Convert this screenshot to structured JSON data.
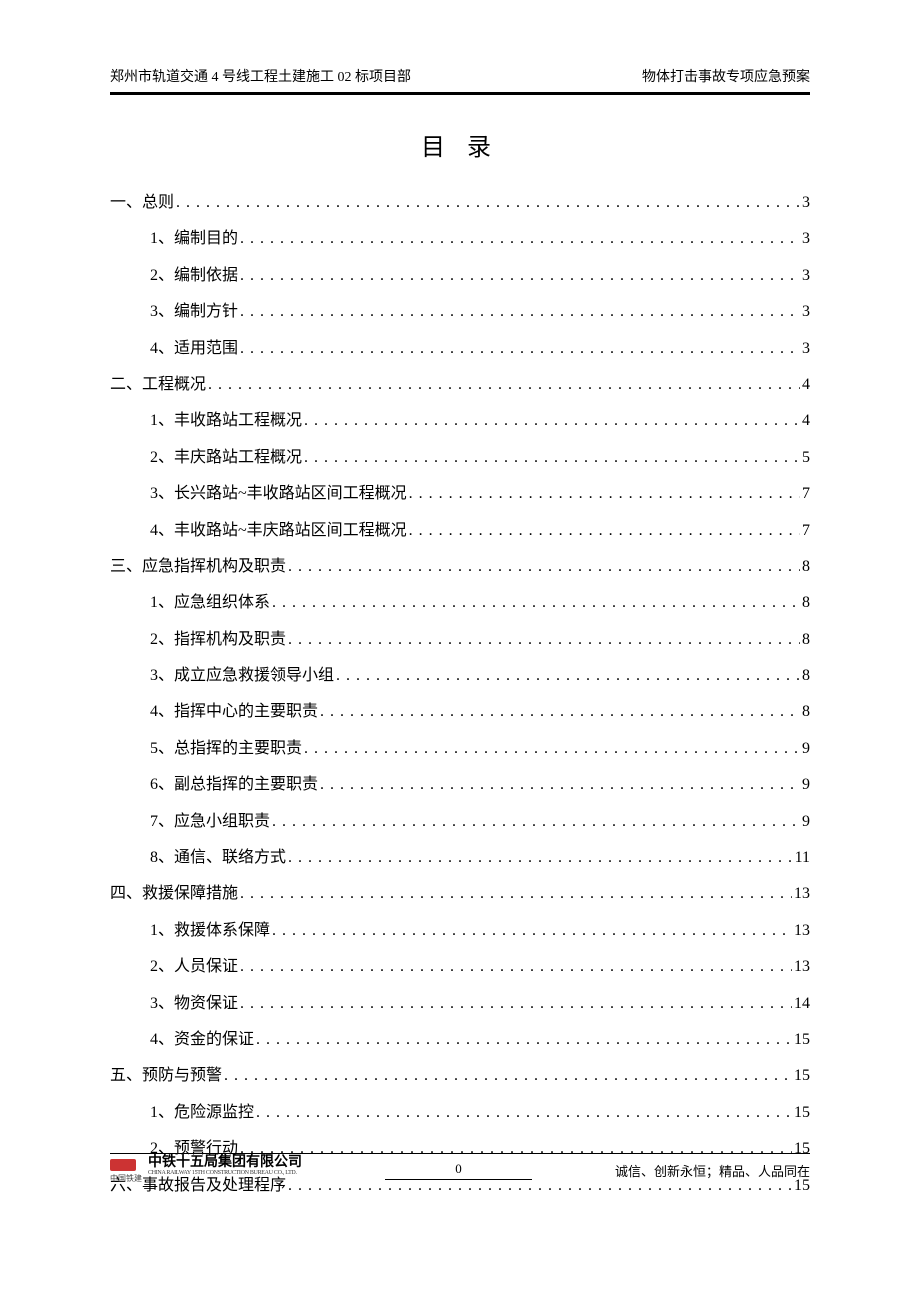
{
  "header": {
    "left": "郑州市轨道交通 4 号线工程土建施工 02 标项目部",
    "right": "物体打击事故专项应急预案"
  },
  "title": "目 录",
  "toc": [
    {
      "level": 1,
      "label": "一、总则",
      "page": "3"
    },
    {
      "level": 2,
      "label": "1、编制目的",
      "page": "3"
    },
    {
      "level": 2,
      "label": "2、编制依据",
      "page": "3"
    },
    {
      "level": 2,
      "label": "3、编制方针",
      "page": "3"
    },
    {
      "level": 2,
      "label": "4、适用范围",
      "page": "3"
    },
    {
      "level": 1,
      "label": "二、工程概况",
      "page": "4"
    },
    {
      "level": 2,
      "label": "1、丰收路站工程概况",
      "page": "4"
    },
    {
      "level": 2,
      "label": "2、丰庆路站工程概况",
      "page": "5"
    },
    {
      "level": 2,
      "label": "3、长兴路站~丰收路站区间工程概况",
      "page": "7"
    },
    {
      "level": 2,
      "label": "4、丰收路站~丰庆路站区间工程概况",
      "page": "7"
    },
    {
      "level": 1,
      "label": "三、应急指挥机构及职责",
      "page": "8"
    },
    {
      "level": 2,
      "label": "1、应急组织体系",
      "page": "8"
    },
    {
      "level": 2,
      "label": "2、指挥机构及职责",
      "page": "8"
    },
    {
      "level": 2,
      "label": "3、成立应急救援领导小组",
      "page": "8"
    },
    {
      "level": 2,
      "label": "4、指挥中心的主要职责",
      "page": "8"
    },
    {
      "level": 2,
      "label": "5、总指挥的主要职责",
      "page": "9"
    },
    {
      "level": 2,
      "label": "6、副总指挥的主要职责",
      "page": "9"
    },
    {
      "level": 2,
      "label": "7、应急小组职责",
      "page": "9"
    },
    {
      "level": 2,
      "label": "8、通信、联络方式",
      "page": "11"
    },
    {
      "level": 1,
      "label": "四、救援保障措施",
      "page": "13"
    },
    {
      "level": 2,
      "label": "1、救援体系保障",
      "page": "13"
    },
    {
      "level": 2,
      "label": "2、人员保证",
      "page": "13"
    },
    {
      "level": 2,
      "label": "3、物资保证",
      "page": "14"
    },
    {
      "level": 2,
      "label": "4、资金的保证",
      "page": "15"
    },
    {
      "level": 1,
      "label": "五、预防与预警",
      "page": "15"
    },
    {
      "level": 2,
      "label": "1、危险源监控",
      "page": "15"
    },
    {
      "level": 2,
      "label": "2、预警行动",
      "page": "15"
    },
    {
      "level": 1,
      "label": "六、事故报告及处理程序",
      "page": "15"
    }
  ],
  "footer": {
    "brand_small": "中国铁建",
    "company_cn": "中铁十五局集团有限公司",
    "company_en": "CHINA RAILWAY 15TH CONSTRUCTION BUREAU CO., LTD.",
    "page_number": "0",
    "slogan": "诚信、创新永恒；精品、人品同在"
  }
}
